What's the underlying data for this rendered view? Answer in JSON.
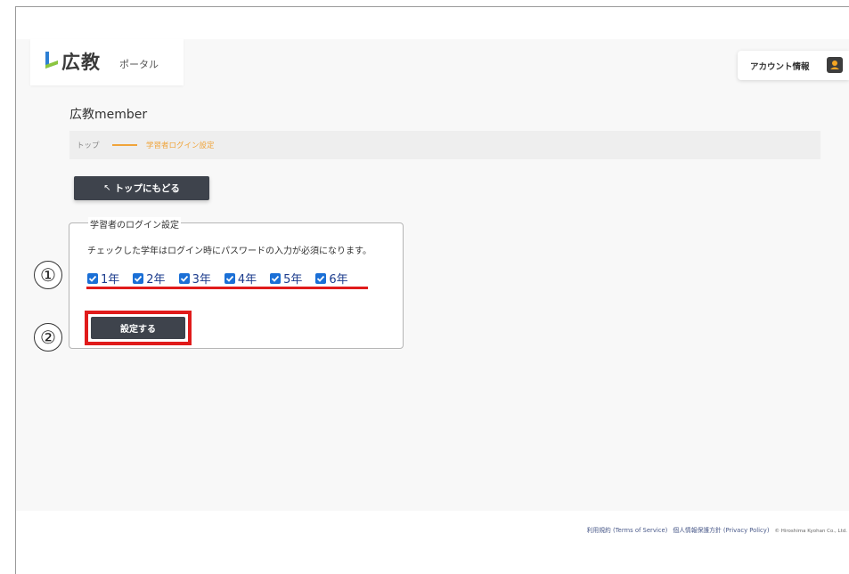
{
  "header": {
    "logo_main": "広教",
    "logo_sub": "ポータル",
    "account_label": "アカウント情報"
  },
  "page": {
    "title": "広教member"
  },
  "breadcrumb": {
    "home": "トップ",
    "current": "学習者ログイン設定"
  },
  "back_button": {
    "arrow": "↖",
    "label": "トップにもどる"
  },
  "settings": {
    "legend": "学習者のログイン設定",
    "description": "チェックした学年はログイン時にパスワードの入力が必須になります。",
    "grades": [
      {
        "label": "1年",
        "checked": true
      },
      {
        "label": "2年",
        "checked": true
      },
      {
        "label": "3年",
        "checked": true
      },
      {
        "label": "4年",
        "checked": true
      },
      {
        "label": "5年",
        "checked": true
      },
      {
        "label": "6年",
        "checked": true
      }
    ],
    "submit_label": "設定する"
  },
  "annotations": {
    "marker1": "①",
    "marker2": "②",
    "highlight_color": "#e01b1b"
  },
  "footer": {
    "terms": "利用規約 (Terms of Service)",
    "privacy": "個人情報保護方針 (Privacy Policy)",
    "copyright": "© Hiroshima Kyohan Co., Ltd."
  },
  "colors": {
    "button_dark": "#3e434c",
    "accent_orange": "#f0a43a",
    "checkbox_blue": "#1a6fd6"
  }
}
